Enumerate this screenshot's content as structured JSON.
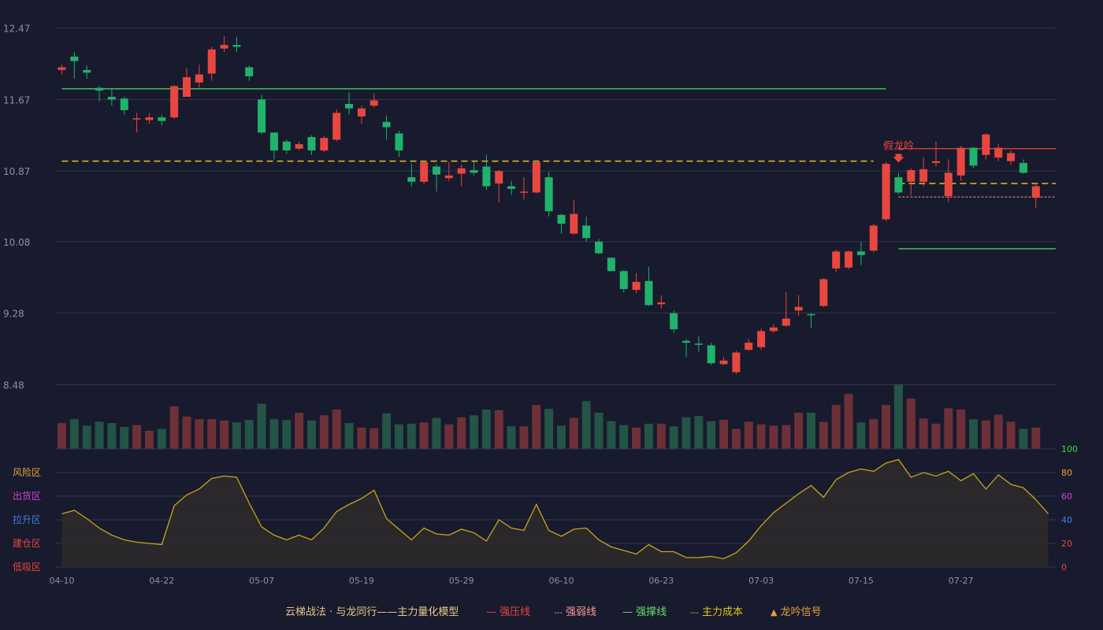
{
  "colors": {
    "background": "#181a2d",
    "up": "#e8473f",
    "down": "#1fb36b",
    "vol_up": "#6e3038",
    "vol_down": "#235446",
    "grid": "#33364a",
    "axis_text": "#8d90a3",
    "pressure": "#e8473f",
    "weak": "#ff8a8a",
    "support": "#3fbf55",
    "cost": "#e6c21a",
    "signal": "#e8a23a",
    "osc_line": "#c7a51b",
    "osc_fill": "#2e2c2c"
  },
  "legend": {
    "title": "云梯战法 · 与龙同行——主力量化模型",
    "items": [
      {
        "label": "强压线",
        "symbol": "—",
        "color": "#e8473f"
      },
      {
        "label": "强弱线",
        "symbol": "---",
        "color": "#ff9a9a"
      },
      {
        "label": "强撑线",
        "symbol": "—",
        "color": "#63e06b"
      },
      {
        "label": "主力成本",
        "symbol": "---",
        "color": "#e6c21a"
      },
      {
        "label": "龙吟信号",
        "symbol": "▲",
        "color": "#e8a23a"
      }
    ]
  },
  "chart_data": {
    "type": "candlestick",
    "price_axis": {
      "ticks": [
        "12.47",
        "11.67",
        "10.87",
        "10.08",
        "9.28",
        "8.48"
      ],
      "range": [
        8.48,
        12.47
      ]
    },
    "x_labels": [
      {
        "label": "04-10",
        "index": 0
      },
      {
        "label": "04-22",
        "index": 8
      },
      {
        "label": "05-07",
        "index": 16
      },
      {
        "label": "05-19",
        "index": 24
      },
      {
        "label": "05-29",
        "index": 32
      },
      {
        "label": "06-10",
        "index": 40
      },
      {
        "label": "06-23",
        "index": 48
      },
      {
        "label": "07-03",
        "index": 56
      },
      {
        "label": "07-15",
        "index": 64
      },
      {
        "label": "07-27",
        "index": 72
      }
    ],
    "candles": [
      [
        12.0,
        12.03,
        12.06,
        11.95
      ],
      [
        12.15,
        12.1,
        12.2,
        11.9
      ],
      [
        12.0,
        11.97,
        12.05,
        11.9
      ],
      [
        11.8,
        11.77,
        11.82,
        11.65
      ],
      [
        11.7,
        11.67,
        11.8,
        11.6
      ],
      [
        11.68,
        11.55,
        11.7,
        11.5
      ],
      [
        11.45,
        11.46,
        11.52,
        11.3
      ],
      [
        11.44,
        11.47,
        11.52,
        11.4
      ],
      [
        11.47,
        11.43,
        11.5,
        11.38
      ],
      [
        11.47,
        11.82,
        11.83,
        11.45
      ],
      [
        11.7,
        11.92,
        12.02,
        11.7
      ],
      [
        11.86,
        11.95,
        12.06,
        11.8
      ],
      [
        11.96,
        12.23,
        12.26,
        11.88
      ],
      [
        12.24,
        12.28,
        12.38,
        12.2
      ],
      [
        12.28,
        12.26,
        12.37,
        12.2
      ],
      [
        12.03,
        11.93,
        12.05,
        11.88
      ],
      [
        11.67,
        11.3,
        11.72,
        11.28
      ],
      [
        11.3,
        11.1,
        11.3,
        11.0
      ],
      [
        11.2,
        11.1,
        11.22,
        11.06
      ],
      [
        11.12,
        11.17,
        11.2,
        11.1
      ],
      [
        11.25,
        11.1,
        11.27,
        11.05
      ],
      [
        11.1,
        11.24,
        11.26,
        11.08
      ],
      [
        11.22,
        11.52,
        11.56,
        11.2
      ],
      [
        11.62,
        11.57,
        11.75,
        11.5
      ],
      [
        11.48,
        11.57,
        11.6,
        11.4
      ],
      [
        11.6,
        11.66,
        11.74,
        11.58
      ],
      [
        11.42,
        11.36,
        11.49,
        11.22
      ],
      [
        11.29,
        11.1,
        11.32,
        11.03
      ],
      [
        10.8,
        10.75,
        10.95,
        10.7
      ],
      [
        10.75,
        10.97,
        10.98,
        10.72
      ],
      [
        10.92,
        10.83,
        10.95,
        10.64
      ],
      [
        10.79,
        10.82,
        10.97,
        10.76
      ],
      [
        10.84,
        10.9,
        10.94,
        10.7
      ],
      [
        10.88,
        10.85,
        10.98,
        10.82
      ],
      [
        10.92,
        10.7,
        11.05,
        10.66
      ],
      [
        10.73,
        10.87,
        10.88,
        10.52
      ],
      [
        10.7,
        10.67,
        10.76,
        10.6
      ],
      [
        10.63,
        10.64,
        10.8,
        10.55
      ],
      [
        10.63,
        10.97,
        10.99,
        10.62
      ],
      [
        10.8,
        10.42,
        10.86,
        10.36
      ],
      [
        10.38,
        10.28,
        10.39,
        10.17
      ],
      [
        10.17,
        10.39,
        10.55,
        10.16
      ],
      [
        10.26,
        10.12,
        10.36,
        10.08
      ],
      [
        10.08,
        9.95,
        10.11,
        9.94
      ],
      [
        9.9,
        9.75,
        9.9,
        9.75
      ],
      [
        9.75,
        9.55,
        9.76,
        9.51
      ],
      [
        9.54,
        9.63,
        9.73,
        9.5
      ],
      [
        9.64,
        9.37,
        9.8,
        9.36
      ],
      [
        9.38,
        9.4,
        9.48,
        9.33
      ],
      [
        9.28,
        9.1,
        9.31,
        9.06
      ],
      [
        8.97,
        8.95,
        8.99,
        8.79
      ],
      [
        8.94,
        8.93,
        9.02,
        8.85
      ],
      [
        8.92,
        8.72,
        8.95,
        8.7
      ],
      [
        8.71,
        8.75,
        8.79,
        8.7
      ],
      [
        8.62,
        8.84,
        8.86,
        8.6
      ],
      [
        8.87,
        8.95,
        8.99,
        8.86
      ],
      [
        8.9,
        9.08,
        9.11,
        8.87
      ],
      [
        9.08,
        9.12,
        9.16,
        9.06
      ],
      [
        9.14,
        9.22,
        9.52,
        9.13
      ],
      [
        9.31,
        9.35,
        9.48,
        9.25
      ],
      [
        9.27,
        9.26,
        9.28,
        9.11
      ],
      [
        9.36,
        9.66,
        9.67,
        9.35
      ],
      [
        9.78,
        9.97,
        9.99,
        9.74
      ],
      [
        9.79,
        9.97,
        9.98,
        9.77
      ],
      [
        9.97,
        9.93,
        10.08,
        9.82
      ],
      [
        9.98,
        10.26,
        10.28,
        9.96
      ],
      [
        10.33,
        10.95,
        10.97,
        10.31
      ],
      [
        10.8,
        10.63,
        10.85,
        10.61
      ],
      [
        10.75,
        10.88,
        10.9,
        10.6
      ],
      [
        10.75,
        10.89,
        11.02,
        10.7
      ],
      [
        10.96,
        10.98,
        11.2,
        10.92
      ],
      [
        10.59,
        10.85,
        11.0,
        10.52
      ],
      [
        10.82,
        11.13,
        11.15,
        10.76
      ],
      [
        11.13,
        10.93,
        11.14,
        10.9
      ],
      [
        11.05,
        11.28,
        11.29,
        11.0
      ],
      [
        11.02,
        11.13,
        11.17,
        10.98
      ],
      [
        10.98,
        11.07,
        11.1,
        10.94
      ],
      [
        10.96,
        10.85,
        11.0,
        10.84
      ],
      [
        10.57,
        10.7,
        10.74,
        10.46
      ]
    ],
    "pressure_line": 11.12,
    "weak_line": 10.58,
    "support_line_1": 11.79,
    "support_line_2": 10.0,
    "cost_line_1": 10.98,
    "cost_line_2": 10.73,
    "signal_label": "假龙吟",
    "signal_index": 67,
    "volume": [
      0.4,
      0.46,
      0.36,
      0.42,
      0.4,
      0.34,
      0.37,
      0.28,
      0.31,
      0.66,
      0.5,
      0.46,
      0.46,
      0.44,
      0.41,
      0.45,
      0.7,
      0.46,
      0.45,
      0.56,
      0.44,
      0.52,
      0.61,
      0.4,
      0.33,
      0.32,
      0.55,
      0.38,
      0.39,
      0.41,
      0.48,
      0.38,
      0.49,
      0.52,
      0.61,
      0.6,
      0.35,
      0.35,
      0.68,
      0.62,
      0.36,
      0.48,
      0.74,
      0.56,
      0.43,
      0.37,
      0.33,
      0.39,
      0.39,
      0.35,
      0.49,
      0.51,
      0.43,
      0.45,
      0.31,
      0.42,
      0.38,
      0.36,
      0.37,
      0.56,
      0.56,
      0.42,
      0.68,
      0.85,
      0.41,
      0.46,
      0.68,
      1.0,
      0.78,
      0.47,
      0.39,
      0.63,
      0.61,
      0.46,
      0.44,
      0.53,
      0.42,
      0.31,
      0.33,
      0.43
    ],
    "oscillator": {
      "axis": [
        "100",
        "80",
        "60",
        "40",
        "20",
        "0"
      ],
      "zones": [
        "风险区",
        "出货区",
        "拉升区",
        "建仓区",
        "低吸区"
      ],
      "values": [
        45,
        48,
        41,
        33,
        27,
        23,
        21,
        20,
        19,
        52,
        61,
        66,
        75,
        77,
        76,
        54,
        34,
        27,
        23,
        27,
        23,
        33,
        47,
        53,
        58,
        65,
        41,
        32,
        23,
        33,
        28,
        27,
        32,
        29,
        22,
        40,
        33,
        31,
        53,
        31,
        26,
        32,
        33,
        23,
        17,
        14,
        11,
        19,
        13,
        13,
        8,
        8,
        9,
        7,
        12,
        22,
        35,
        46,
        54,
        62,
        69,
        59,
        74,
        80,
        83,
        81,
        88,
        91,
        76,
        80,
        77,
        81,
        73,
        79,
        66,
        78,
        70,
        67,
        57,
        45
      ]
    }
  }
}
